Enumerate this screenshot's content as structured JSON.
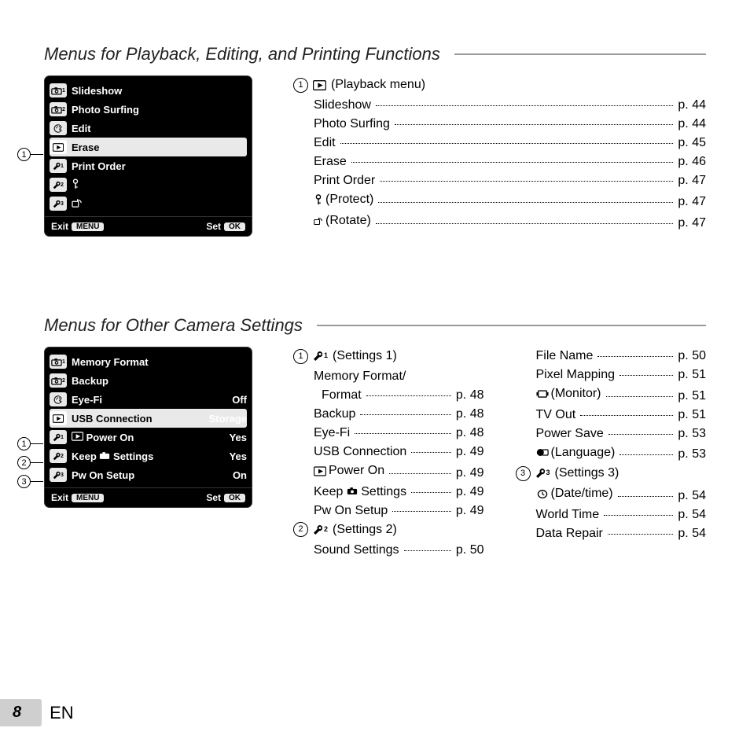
{
  "page_number": "8",
  "language_code": "EN",
  "sections": {
    "playback": {
      "heading": "Menus for Playback, Editing, and Printing Functions",
      "callout_label": "1",
      "menu_head": "(Playback menu)",
      "lcd": {
        "tabs": [
          "1",
          "2",
          "",
          "",
          "T1",
          "T2",
          "T3"
        ],
        "items": [
          {
            "label": "Slideshow"
          },
          {
            "label": "Photo Surfing"
          },
          {
            "label": "Edit"
          },
          {
            "label": "Erase",
            "highlight": true
          },
          {
            "label": "Print Order"
          },
          {
            "label": ""
          },
          {
            "label": ""
          }
        ],
        "exit": "Exit",
        "exit_btn": "MENU",
        "set": "Set",
        "set_btn": "OK"
      },
      "index": [
        {
          "label": "Slideshow",
          "page": "p. 44"
        },
        {
          "label": "Photo Surfing",
          "page": "p. 44"
        },
        {
          "label": "Edit",
          "page": "p. 45"
        },
        {
          "label": "Erase",
          "page": "p. 46"
        },
        {
          "label": "Print Order",
          "page": "p. 47"
        },
        {
          "label": "(Protect)",
          "icon": "key",
          "page": "p. 47"
        },
        {
          "label": "(Rotate)",
          "icon": "rotate",
          "page": "p. 47"
        }
      ]
    },
    "other": {
      "heading": "Menus for Other Camera Settings",
      "lcd": {
        "items": [
          {
            "label": "Memory Format",
            "value": ""
          },
          {
            "label": "Backup",
            "value": ""
          },
          {
            "label": "Eye-Fi",
            "value": "Off"
          },
          {
            "label": "USB Connection",
            "value": "Storage",
            "highlight": true
          },
          {
            "label": "Power On",
            "value": "Yes",
            "prefix_icon": "play"
          },
          {
            "label": "Keep     Settings",
            "value": "Yes",
            "mid_icon": "camera"
          },
          {
            "label": "Pw On Setup",
            "value": "On"
          }
        ],
        "exit": "Exit",
        "exit_btn": "MENU",
        "set": "Set",
        "set_btn": "OK"
      },
      "callouts": [
        "1",
        "2",
        "3"
      ],
      "columns": [
        [
          {
            "type": "head",
            "num": "1",
            "icon": "wrench1",
            "label": "(Settings 1)"
          },
          {
            "type": "item",
            "label": "Memory Format/",
            "nopage": true,
            "noindent": false
          },
          {
            "type": "item",
            "label": "Format",
            "page": "p. 48",
            "indent": true
          },
          {
            "type": "item",
            "label": "Backup",
            "page": "p. 48"
          },
          {
            "type": "item",
            "label": "Eye-Fi",
            "page": "p. 48"
          },
          {
            "type": "item",
            "label": "USB Connection",
            "page": "p. 49"
          },
          {
            "type": "item",
            "icon": "play",
            "label": "Power On",
            "page": "p. 49"
          },
          {
            "type": "item",
            "label": "Keep      Settings",
            "mid_icon": "camera",
            "page": "p. 49"
          },
          {
            "type": "item",
            "label": "Pw On Setup",
            "page": "p. 49"
          },
          {
            "type": "head",
            "num": "2",
            "icon": "wrench2",
            "label": "(Settings 2)"
          },
          {
            "type": "item",
            "label": "Sound Settings",
            "page": "p. 50"
          }
        ],
        [
          {
            "type": "item",
            "label": "File Name",
            "page": "p. 50"
          },
          {
            "type": "item",
            "label": "Pixel Mapping",
            "page": "p. 51"
          },
          {
            "type": "item",
            "icon": "monitor",
            "label": "(Monitor)",
            "page": "p. 51"
          },
          {
            "type": "item",
            "label": "TV Out",
            "page": "p. 51"
          },
          {
            "type": "item",
            "label": "Power Save",
            "page": "p. 53"
          },
          {
            "type": "item",
            "icon": "language",
            "label": "(Language)",
            "page": "p. 53"
          },
          {
            "type": "head",
            "num": "3",
            "icon": "wrench3",
            "label": "(Settings 3)"
          },
          {
            "type": "item",
            "icon": "clock",
            "label": "(Date/time)",
            "page": "p. 54"
          },
          {
            "type": "item",
            "label": "World Time",
            "page": "p. 54"
          },
          {
            "type": "item",
            "label": "Data Repair",
            "page": "p. 54"
          }
        ]
      ]
    }
  }
}
